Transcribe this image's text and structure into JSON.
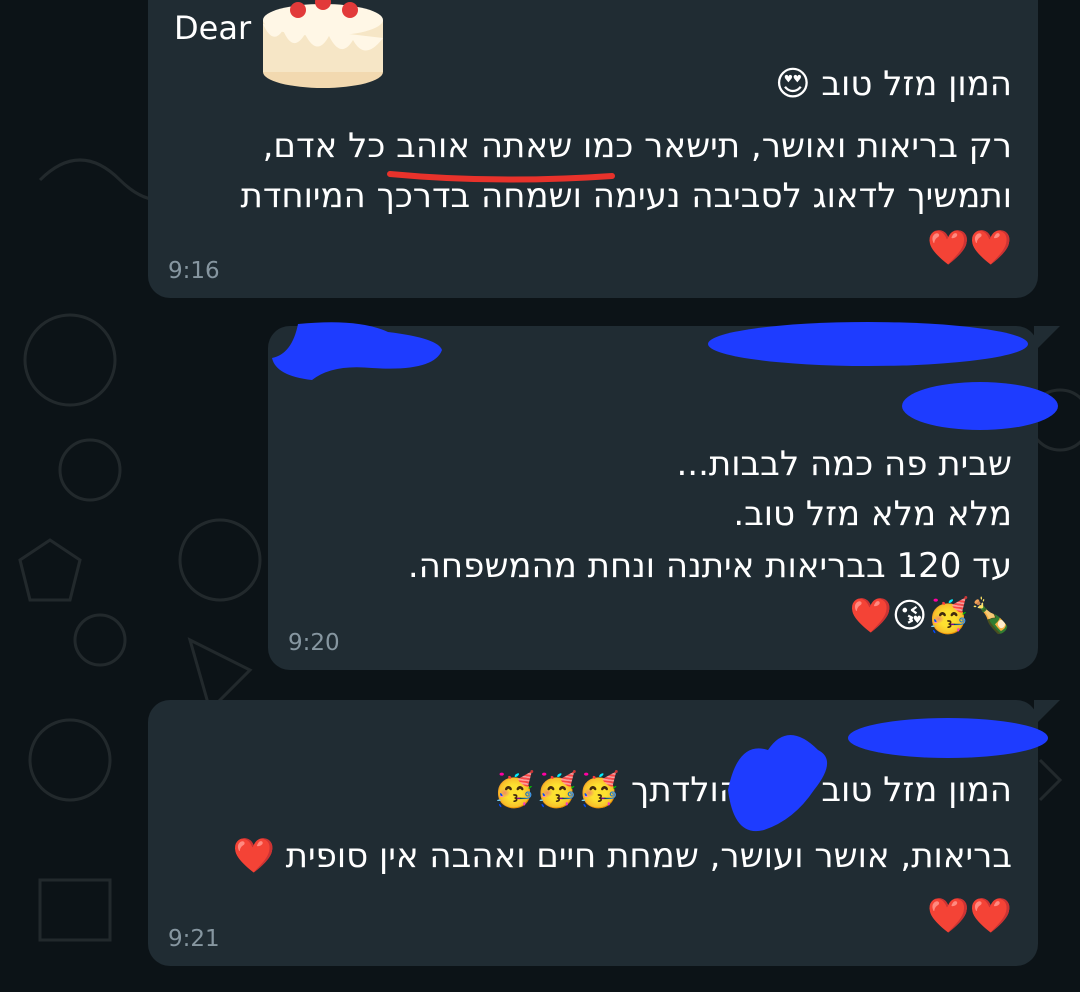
{
  "chat": {
    "messages": [
      {
        "greeting": "Dear",
        "lines": [
          "המון מזל טוב 😍",
          "רק בריאות ואושר,  תישאר כמו שאתה אוהב כל אדם,",
          "ותמשיך לדאוג לסביבה נעימה ושמחה בדרכך המיוחדת",
          "❤️❤️"
        ],
        "time": "9:16"
      },
      {
        "lines": [
          "שבית פה כמה לבבות...",
          "מלא מלא מזל טוב.",
          "עד 120 בבריאות איתנה ונחת מהמשפחה.",
          "🍾🥳😘❤️"
        ],
        "time": "9:20"
      },
      {
        "lines": [
          "המון מזל טוב         ליום הולדתך 🥳🥳🥳",
          "בריאות, אושר ועושר, שמחת חיים ואהבה אין סופית ❤️",
          "❤️❤️"
        ],
        "time": "9:21"
      }
    ]
  },
  "colors": {
    "background": "#0c1317",
    "bubble": "#202c33",
    "text": "#ffffff",
    "timestamp": "#8696a0",
    "redaction": "#1e3cff",
    "underline": "#e8322b"
  }
}
